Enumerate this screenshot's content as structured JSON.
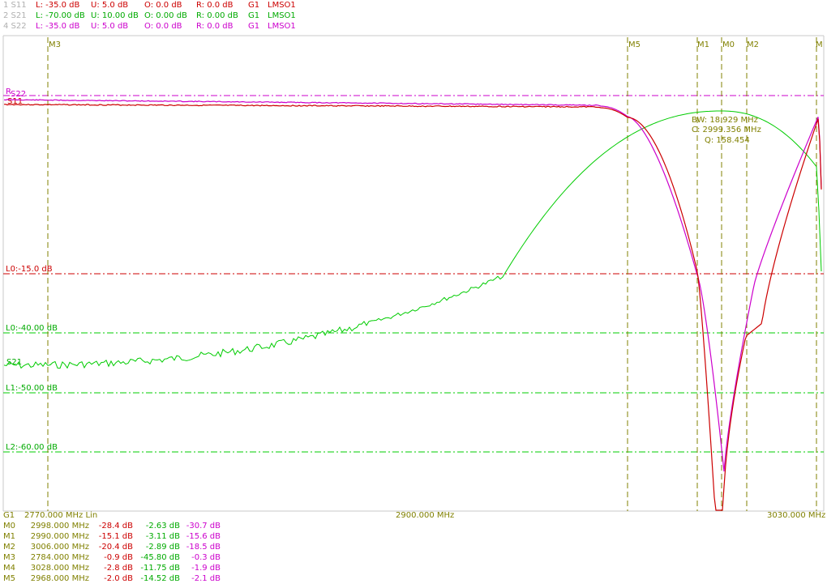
{
  "colors": {
    "s11": "#cc0000",
    "s21": "#00cc00",
    "s22": "#cc00cc",
    "marker": "#808000",
    "text_dim": "#b0b0b0",
    "frame": "#c0c0c0"
  },
  "traces": [
    {
      "id": "1 S11",
      "L": "L: -35.0 dB",
      "U": "U:  5.0 dB",
      "O": "O:  0.0 dB",
      "R": "R:  0.0 dB",
      "G": "G1",
      "src": "LMSO1",
      "color_key": "s11"
    },
    {
      "id": "2 S21",
      "L": "L: -70.00 dB",
      "U": "U: 10.00 dB",
      "O": "O:  0.00 dB",
      "R": "R:  0.00 dB",
      "G": "G1",
      "src": "LMSO1",
      "color_key": "s21"
    },
    {
      "id": "4 S22",
      "L": "L: -35.0 dB",
      "U": "U:  5.0 dB",
      "O": "O:  0.0 dB",
      "R": "R:  0.0 dB",
      "G": "G1",
      "src": "LMSO1",
      "color_key": "s22"
    }
  ],
  "trace_labels": {
    "s11": "S11",
    "s21": "S21",
    "s22": "S22",
    "ref": "R"
  },
  "limit_labels": {
    "s11_l0": "L0:-15.0 dB",
    "s21_l0": "L0:-40.00 dB",
    "s21_l1": "L1:-50.00 dB",
    "s21_l2": "L2:-60.00 dB"
  },
  "bw_readout": {
    "bw": "BW:  18.929 MHz",
    "center": "C:  2999.356 MHz",
    "q": "Q:  158.454"
  },
  "axis": {
    "group": "G1",
    "start": "2770.000 MHz Lin",
    "center": "2900.000 MHz",
    "stop": "3030.000 MHz"
  },
  "marker_labels": [
    "M3",
    "M5",
    "M1",
    "M0",
    "M2",
    "M"
  ],
  "markers": [
    {
      "name": "M0",
      "freq": "2998.000 MHz",
      "s11": "-28.4 dB",
      "s21": "-2.63 dB",
      "s22": "-30.7 dB"
    },
    {
      "name": "M1",
      "freq": "2990.000 MHz",
      "s11": "-15.1 dB",
      "s21": "-3.11 dB",
      "s22": "-15.6 dB"
    },
    {
      "name": "M2",
      "freq": "3006.000 MHz",
      "s11": "-20.4 dB",
      "s21": "-2.89 dB",
      "s22": "-18.5 dB"
    },
    {
      "name": "M3",
      "freq": "2784.000 MHz",
      "s11": "-0.9 dB",
      "s21": "-45.80 dB",
      "s22": "-0.3 dB"
    },
    {
      "name": "M4",
      "freq": "3028.000 MHz",
      "s11": "-2.8 dB",
      "s21": "-11.75 dB",
      "s22": "-1.9 dB"
    },
    {
      "name": "M5",
      "freq": "2968.000 MHz",
      "s11": "-2.0 dB",
      "s21": "-14.52 dB",
      "s22": "-2.1 dB"
    }
  ]
}
